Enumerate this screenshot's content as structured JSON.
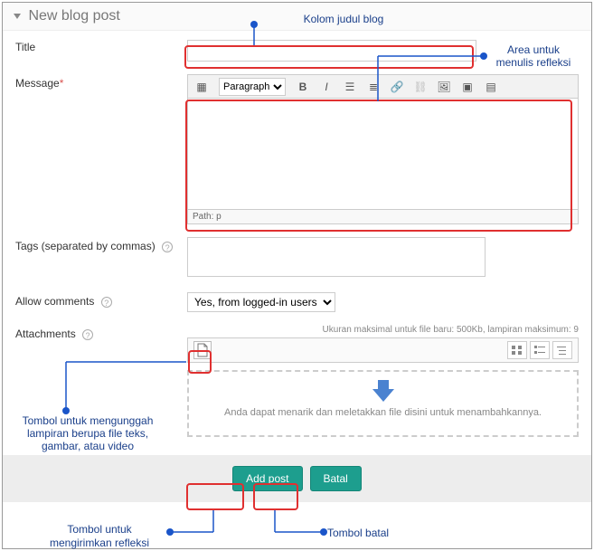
{
  "header": {
    "title": "New blog post"
  },
  "labels": {
    "title": "Title",
    "message": "Message",
    "tags": "Tags (separated by commas)",
    "allow_comments": "Allow comments",
    "attachments": "Attachments"
  },
  "editor": {
    "paragraph": "Paragraph",
    "path": "Path: p"
  },
  "allow_comments": {
    "selected": "Yes, from logged-in users"
  },
  "attachments": {
    "info": "Ukuran maksimal untuk file baru: 500Kb, lampiran maksimum: 9",
    "drop_hint": "Anda dapat menarik dan meletakkan file disini untuk menambahkannya."
  },
  "buttons": {
    "add_post": "Add post",
    "cancel": "Batal"
  },
  "annotations": {
    "title_col": "Kolom judul blog",
    "write_area": "Area untuk menulis refleksi",
    "upload_btn": "Tombol untuk mengunggah lampiran berupa file teks, gambar, atau video",
    "send_btn": "Tombol untuk mengirimkan refleksi",
    "cancel_btn": "Tombol batal"
  }
}
